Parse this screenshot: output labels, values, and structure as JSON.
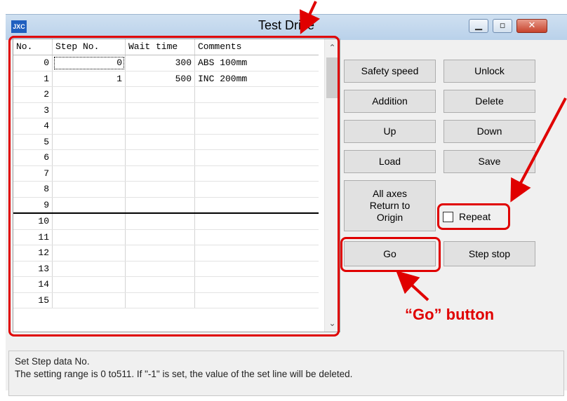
{
  "window": {
    "app_icon_text": "JXC",
    "title": "Test Drive",
    "controls": {
      "minimize_icon": "minimize-icon",
      "maximize_icon": "maximize-icon",
      "close_icon": "close-icon"
    }
  },
  "table": {
    "headers": [
      "No.",
      "Step No.",
      "Wait time",
      "Comments"
    ],
    "rows": [
      {
        "no": "0",
        "step": "0",
        "wait": "300",
        "comment": "ABS 100mm"
      },
      {
        "no": "1",
        "step": "1",
        "wait": "500",
        "comment": "INC 200mm"
      },
      {
        "no": "2",
        "step": "",
        "wait": "",
        "comment": ""
      },
      {
        "no": "3",
        "step": "",
        "wait": "",
        "comment": ""
      },
      {
        "no": "4",
        "step": "",
        "wait": "",
        "comment": ""
      },
      {
        "no": "5",
        "step": "",
        "wait": "",
        "comment": ""
      },
      {
        "no": "6",
        "step": "",
        "wait": "",
        "comment": ""
      },
      {
        "no": "7",
        "step": "",
        "wait": "",
        "comment": ""
      },
      {
        "no": "8",
        "step": "",
        "wait": "",
        "comment": ""
      },
      {
        "no": "9",
        "step": "",
        "wait": "",
        "comment": ""
      },
      {
        "no": "10",
        "step": "",
        "wait": "",
        "comment": ""
      },
      {
        "no": "11",
        "step": "",
        "wait": "",
        "comment": ""
      },
      {
        "no": "12",
        "step": "",
        "wait": "",
        "comment": ""
      },
      {
        "no": "13",
        "step": "",
        "wait": "",
        "comment": ""
      },
      {
        "no": "14",
        "step": "",
        "wait": "",
        "comment": ""
      },
      {
        "no": "15",
        "step": "",
        "wait": "",
        "comment": ""
      }
    ]
  },
  "buttons": {
    "safety_speed": "Safety speed",
    "unlock": "Unlock",
    "addition": "Addition",
    "delete": "Delete",
    "up": "Up",
    "down": "Down",
    "load": "Load",
    "save": "Save",
    "return_origin": "All axes\nReturn to\nOrigin",
    "go": "Go",
    "step_stop": "Step stop"
  },
  "repeat": {
    "label": "Repeat",
    "checked": false
  },
  "status": {
    "line1": "Set Step data No.",
    "line2": "The setting range is 0 to511.  If \"-1\" is set, the value of the set line will be deleted."
  },
  "annotations": {
    "go_button_label": "“Go” button",
    "color": "#e00000"
  }
}
